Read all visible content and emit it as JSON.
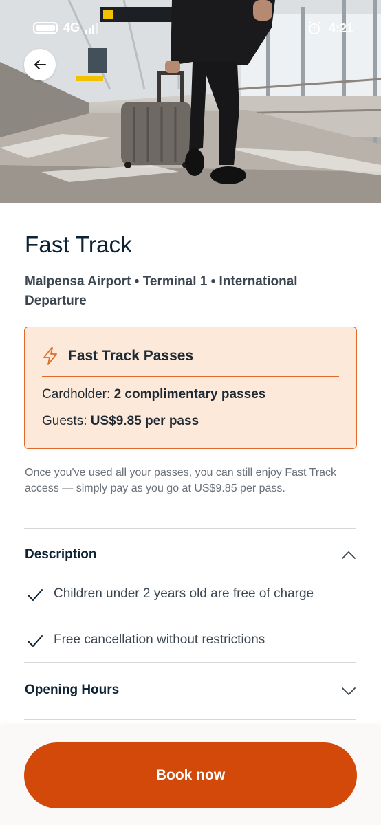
{
  "status_bar": {
    "network": "4G",
    "time": "4:21",
    "icons": [
      "battery-icon",
      "signal-icon",
      "alarm-icon"
    ]
  },
  "hero": {
    "image": "airport-traveler-with-suitcase-photo",
    "back_icon": "arrow-left-icon"
  },
  "header": {
    "title": "Fast Track",
    "subtitle": "Malpensa Airport • Terminal 1 • International Departure"
  },
  "passes": {
    "icon": "lightning-icon",
    "title": "Fast Track Passes",
    "cardholder_label": "Cardholder:",
    "cardholder_value": "2 complimentary passes",
    "guests_label": "Guests:",
    "guests_value": "US$9.85 per pass",
    "accent_color": "#e06a2a",
    "background_color": "#fde9d9"
  },
  "note": "Once you've used all your passes, you can still enjoy Fast Track access — simply pay as you go at US$9.85 per pass.",
  "description": {
    "title": "Description",
    "expanded": true,
    "items": [
      {
        "icon": "check-icon",
        "text": "Children under 2 years old are free of charge"
      },
      {
        "icon": "check-icon",
        "text": "Free cancellation without restrictions"
      }
    ]
  },
  "opening_hours": {
    "title": "Opening Hours",
    "expanded": false
  },
  "footer": {
    "cta_label": "Book now",
    "cta_color": "#d2490a"
  }
}
